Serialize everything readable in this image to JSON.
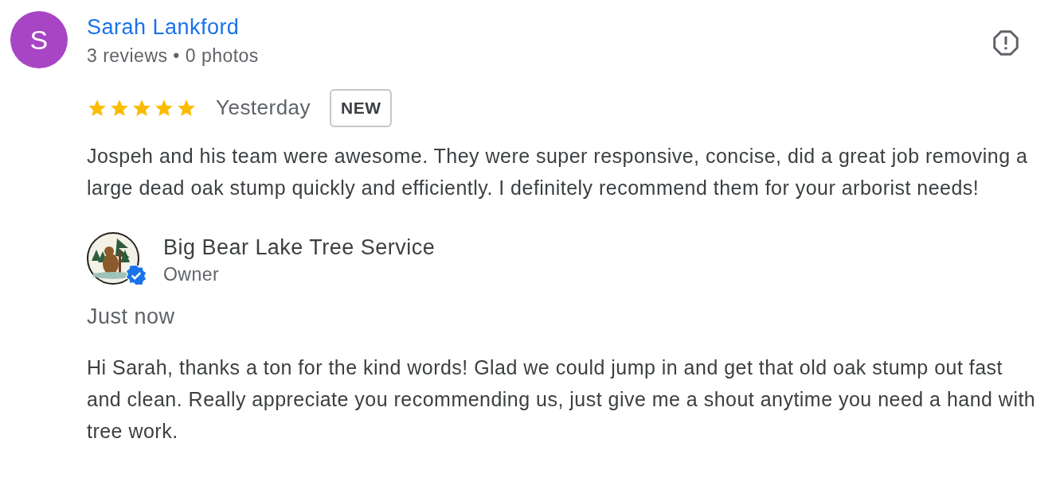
{
  "review": {
    "avatar_letter": "S",
    "color": "#a845c4",
    "author": "Sarah Lankford",
    "meta": "3 reviews • 0 photos",
    "stars": 5,
    "date": "Yesterday",
    "badge": "NEW",
    "text": "Jospeh and his team were awesome. They were super responsive, concise, did a great job removing a large dead oak stump quickly and efficiently. I definitely recommend them for your arborist needs!"
  },
  "reply": {
    "business": "Big Bear Lake Tree Service",
    "role": "Owner",
    "verified": true,
    "date": "Just now",
    "text": "Hi Sarah, thanks a ton for the kind words! Glad we could jump in and get that old oak stump out fast and clean. Really appreciate you recommending us, just give me a shout anytime you need a hand with tree work."
  }
}
